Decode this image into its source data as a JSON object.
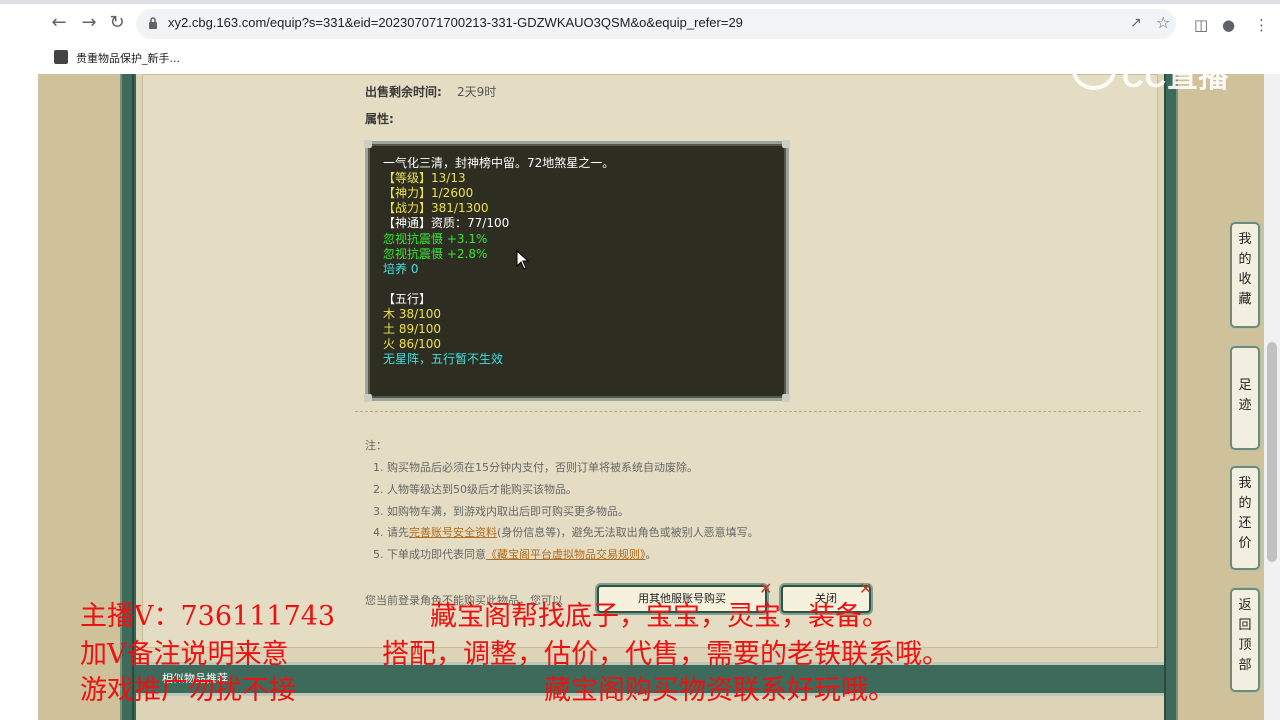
{
  "browser": {
    "url": "xy2.cbg.163.com/equip?s=331&eid=202307071700213-331-GDZWKAUO3QSM&o&equip_refer=29",
    "bookmark_label": "贵重物品保护_新手..."
  },
  "watermark": {
    "text": "CC直播"
  },
  "item": {
    "sale_time_label": "出售剩余时间:",
    "sale_time_value": "2天9时",
    "attr_label": "属性:",
    "stats": [
      {
        "text": "一气化三清，封神榜中留。72地煞星之一。",
        "color": "white"
      },
      {
        "text": "【等级】13/13",
        "color": "yellow"
      },
      {
        "text": "【神力】1/2600",
        "color": "yellow"
      },
      {
        "text": "【战力】381/1300",
        "color": "yellow"
      },
      {
        "text": "【神通】资质：77/100",
        "color": "white"
      },
      {
        "text": "忽视抗震慑 +3.1%",
        "color": "green"
      },
      {
        "text": "忽视抗震慑 +2.8%",
        "color": "green"
      },
      {
        "text": "培养 0",
        "color": "cyan"
      },
      {
        "text": "",
        "color": "white"
      },
      {
        "text": "【五行】",
        "color": "white"
      },
      {
        "text": "木 38/100",
        "color": "yellow"
      },
      {
        "text": "土 89/100",
        "color": "yellow"
      },
      {
        "text": "火 86/100",
        "color": "yellow"
      },
      {
        "text": "无星阵，五行暂不生效",
        "color": "cyan"
      }
    ]
  },
  "notes": {
    "title": "注：",
    "items": [
      {
        "text": "1. 购买物品后必须在15分钟内支付，否则订单将被系统自动废除。"
      },
      {
        "text": "2. 人物等级达到50级后才能购买该物品。"
      },
      {
        "text": "3. 如购物车满，到游戏内取出后即可购买更多物品。"
      },
      {
        "pre": "4. 请先",
        "link": "完善账号安全资料",
        "post": "(身份信息等)，避免无法取出角色或被别人恶意填写。"
      },
      {
        "pre": "5. 下单成功即代表同意",
        "link": "《藏宝阁平台虚拟物品交易规则》",
        "post": "。"
      }
    ]
  },
  "purchase": {
    "login_tip": "您当前登录角色不能购买此物品，您可以",
    "other_account_button": "用其他服账号购买",
    "close_button": "关闭"
  },
  "recommend": {
    "title": "相似物品推荐"
  },
  "side_nav": [
    {
      "label": "我的收藏",
      "chars": [
        "我",
        "的",
        "收",
        "藏"
      ]
    },
    {
      "label": "足迹",
      "chars": [
        "足",
        "迹"
      ]
    },
    {
      "label": "我的还价",
      "chars": [
        "我",
        "的",
        "还",
        "价"
      ]
    },
    {
      "label": "返回顶部",
      "chars": [
        "返",
        "回",
        "顶",
        "部"
      ]
    }
  ],
  "overlay": {
    "line1_left": "主播V：736111743",
    "line1_right": "藏宝阁帮找底子，宝宝，灵宝，装备。",
    "line2_left": "加V备注说明来意",
    "line2_right": "搭配，调整，估价，代售，需要的老铁联系哦。",
    "line3_left": "游戏推广勿扰不接",
    "line3_right": "藏宝阁购买物资联系好玩哦。"
  },
  "colors": {
    "accent_red": "#ee1111",
    "frame_green": "#3d6a5b",
    "stat_yellow": "#f0e24a",
    "stat_green": "#37e637",
    "stat_cyan": "#3fe0e0"
  }
}
